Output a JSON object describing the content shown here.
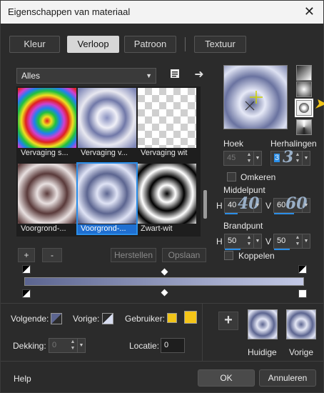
{
  "window": {
    "title": "Eigenschappen van materiaal",
    "close": "✕"
  },
  "tabs": [
    {
      "label": "Kleur"
    },
    {
      "label": "Verloop",
      "active": true
    },
    {
      "label": "Patroon"
    },
    {
      "label": "Textuur"
    }
  ],
  "category": {
    "value": "Alles"
  },
  "gallery": {
    "items": [
      {
        "label": "Vervaging s..."
      },
      {
        "label": "Vervaging v..."
      },
      {
        "label": "Vervaging wit"
      },
      {
        "label": "Voorgrond-..."
      },
      {
        "label": "Voorgrond-...",
        "selected": true
      },
      {
        "label": "Zwart-wit"
      }
    ]
  },
  "stop_buttons": {
    "add": "+",
    "remove": "-",
    "reset": "Herstellen",
    "save": "Opslaan"
  },
  "settings": {
    "angle_label": "Hoek",
    "angle_value": "45",
    "repeats_label": "Herhalingen",
    "repeats_value": "3",
    "repeats_annotation": "3",
    "invert_label": "Omkeren",
    "center_label": "Middelpunt",
    "center_h_label": "H",
    "center_h_value": "40",
    "center_h_annotation": "40",
    "center_v_label": "V",
    "center_v_value": "60",
    "center_v_annotation": "60",
    "focal_label": "Brandpunt",
    "focal_h_label": "H",
    "focal_h_value": "50",
    "focal_v_label": "V",
    "focal_v_value": "50",
    "link_label": "Koppelen"
  },
  "colors": {
    "next_label": "Volgende:",
    "prev_label": "Vorige:",
    "user_label": "Gebruiker:",
    "user_color_1": "#f0c419",
    "user_color_2": "#f5c518",
    "accent": "#2a8ee8"
  },
  "opacity": {
    "label": "Dekking:",
    "value": "0"
  },
  "location": {
    "label": "Locatie:",
    "value": "0"
  },
  "current": {
    "add_symbol": "+",
    "current_label": "Huidige",
    "previous_label": "Vorige"
  },
  "footer": {
    "help": "Help",
    "ok": "OK",
    "cancel": "Annuleren"
  }
}
